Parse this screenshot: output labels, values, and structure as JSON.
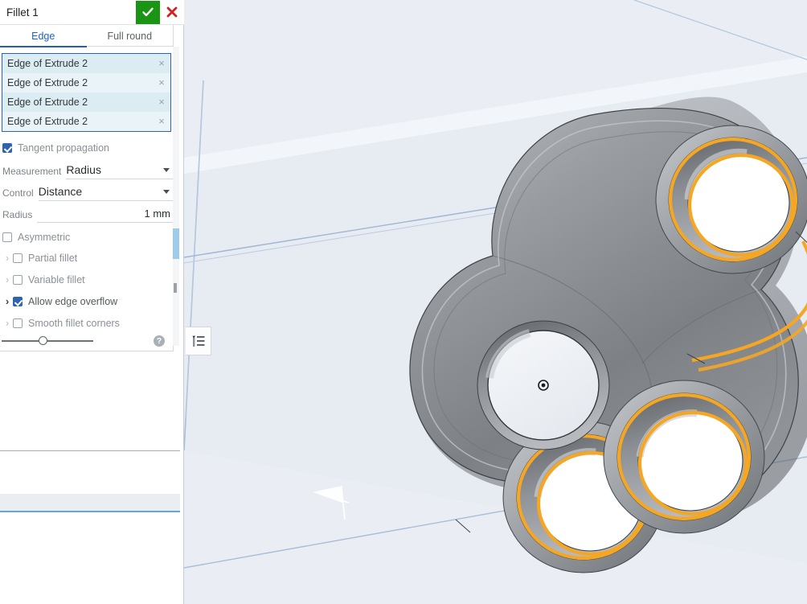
{
  "dialog": {
    "title": "Fillet 1",
    "accept_icon": "checkmark-icon",
    "cancel_icon": "close-icon",
    "accept_color": "#1a9413",
    "cancel_color": "#cc2222",
    "tabs": [
      {
        "label": "Edge",
        "active": true
      },
      {
        "label": "Full round",
        "active": false
      }
    ],
    "entities": [
      {
        "label": "Edge of Extrude 2",
        "remove_icon": "×"
      },
      {
        "label": "Edge of Extrude 2",
        "remove_icon": "×"
      },
      {
        "label": "Edge of Extrude 2",
        "remove_icon": "×"
      },
      {
        "label": "Edge of Extrude 2",
        "remove_icon": "×"
      }
    ],
    "tangent_propagation": {
      "label": "Tangent propagation",
      "checked": true
    },
    "measurement": {
      "label": "Measurement",
      "value": "Radius"
    },
    "control": {
      "label": "Control",
      "value": "Distance"
    },
    "radius": {
      "label": "Radius",
      "value": "1 mm"
    },
    "asymmetric": {
      "label": "Asymmetric",
      "checked": false
    },
    "options": [
      {
        "label": "Partial fillet",
        "checked": false,
        "expanded": false
      },
      {
        "label": "Variable fillet",
        "checked": false,
        "expanded": false
      },
      {
        "label": "Allow edge overflow",
        "checked": true,
        "expanded": true
      },
      {
        "label": "Smooth fillet corners",
        "checked": false,
        "expanded": false
      }
    ],
    "slider": {
      "name": "fillet-slider",
      "value_percent": 45
    },
    "help_label": "?",
    "scrollbar": {
      "name": "panel-scrollbar",
      "thumb_color": "#9fcbea"
    }
  },
  "viewport": {
    "name": "3d-viewport",
    "background_color": "#eaeef4",
    "model_name": "fidget-spinner",
    "highlight_color": "#f5a623",
    "plane_line_color": "#a8bdd8",
    "origin_marker": "origin-point-icon",
    "direction_arrow": "fillet-direction-arrow"
  },
  "feature_tree_toggle": {
    "name": "feature-tree-toggle",
    "icon": "feature-list-icon"
  }
}
